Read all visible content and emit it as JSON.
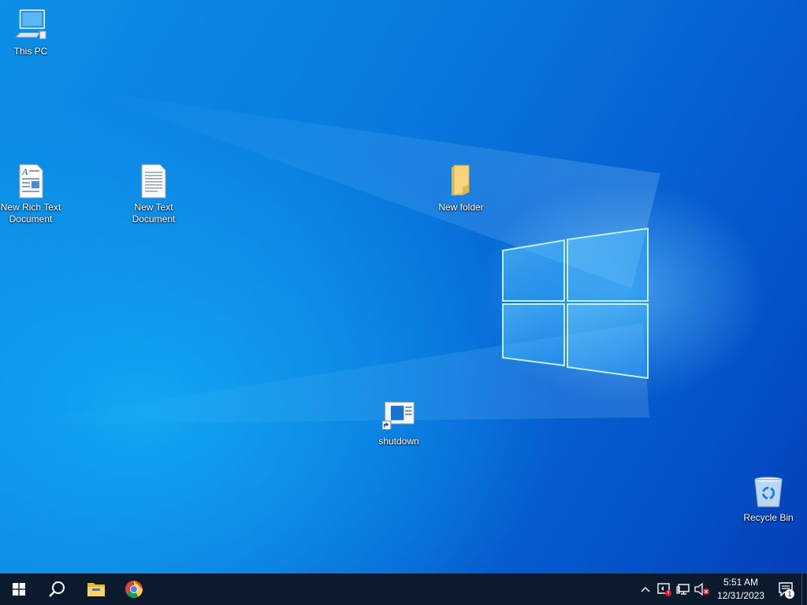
{
  "desktop": {
    "icons": [
      {
        "name": "this-pc",
        "label": "This PC",
        "icon": "computer-icon"
      },
      {
        "name": "new-rich-text-document",
        "label": "New Rich Text\nDocument",
        "icon": "rich-text-document-icon"
      },
      {
        "name": "new-text-document",
        "label": "New Text\nDocument",
        "icon": "text-document-icon"
      },
      {
        "name": "new-folder",
        "label": "New folder",
        "icon": "folder-icon"
      },
      {
        "name": "shutdown",
        "label": "shutdown",
        "icon": "shortcut-icon"
      },
      {
        "name": "recycle-bin",
        "label": "Recycle Bin",
        "icon": "recycle-bin-icon"
      }
    ]
  },
  "taskbar": {
    "start_icon": "windows-start-icon",
    "search_icon": "search-icon",
    "pinned": [
      {
        "name": "file-explorer",
        "icon": "folder-icon"
      },
      {
        "name": "chrome",
        "icon": "chrome-icon"
      }
    ],
    "tray": {
      "icons": [
        "chevron-up-icon",
        "security-warning-icon",
        "network-icon",
        "volume-muted-icon"
      ],
      "time": "5:51 AM",
      "date": "12/31/2023",
      "notification_count": "1"
    }
  },
  "colors": {
    "taskbar_bg": "#0b1a2c",
    "desktop_accent": "#0a7de0"
  }
}
